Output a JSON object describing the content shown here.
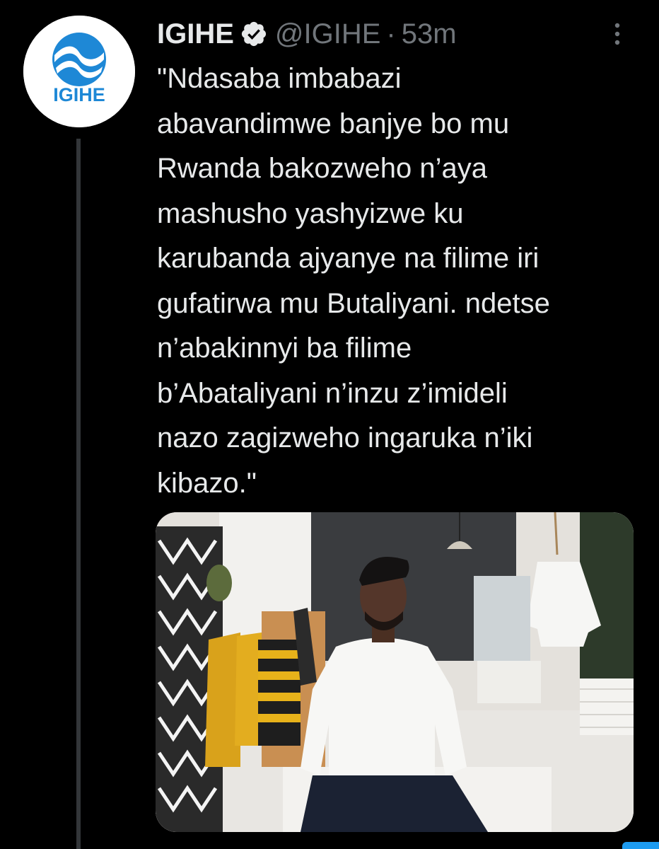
{
  "tweet": {
    "display_name": "IGIHE",
    "handle": "@IGIHE",
    "separator": "·",
    "time": "53m",
    "verified": true,
    "avatar_logo_text": "IGIHE",
    "text": "\"Ndasaba imbabazi\nabavandimwe banjye bo mu\nRwanda bakozweho n’aya\nmashusho yashyizwe ku\nkarubanda ajyanye na filime iri\ngufatirwa mu Butaliyani. ndetse\nn’abakinnyi ba filime\nb’Abataliyani n’inzu z’imideli\nnazo zagizweho ingaruka n’iki\nkibazo.\""
  },
  "icons": {
    "verified": "verified-badge-icon",
    "more": "more-vertical-icon"
  },
  "colors": {
    "background": "#000000",
    "text_primary": "#e7e9ea",
    "text_secondary": "#71767b",
    "verified_blue": "#1d9bf0",
    "logo_blue": "#1e88d6",
    "thread_line": "#333639"
  }
}
